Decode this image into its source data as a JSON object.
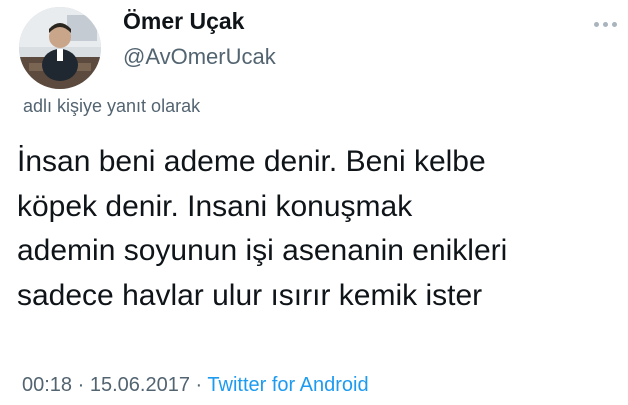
{
  "user": {
    "display_name": "Ömer Uçak",
    "handle": "@AvOmerUcak",
    "avatar_icon": "profile-photo"
  },
  "tweet": {
    "reply_context": "adlı kişiye yanıt olarak",
    "lines": [
      "İnsan beni ademe denir. Beni kelbe",
      "köpek denir. Insani konuşmak",
      "ademin soyunun işi asenanin enikleri",
      "sadece havlar ulur ısırır kemik ister"
    ],
    "time": "00:18",
    "separator": "·",
    "date": "15.06.2017",
    "source": "Twitter for Android"
  },
  "colors": {
    "text": "#0f1419",
    "secondary": "#536471",
    "link": "#1d9bf0"
  }
}
